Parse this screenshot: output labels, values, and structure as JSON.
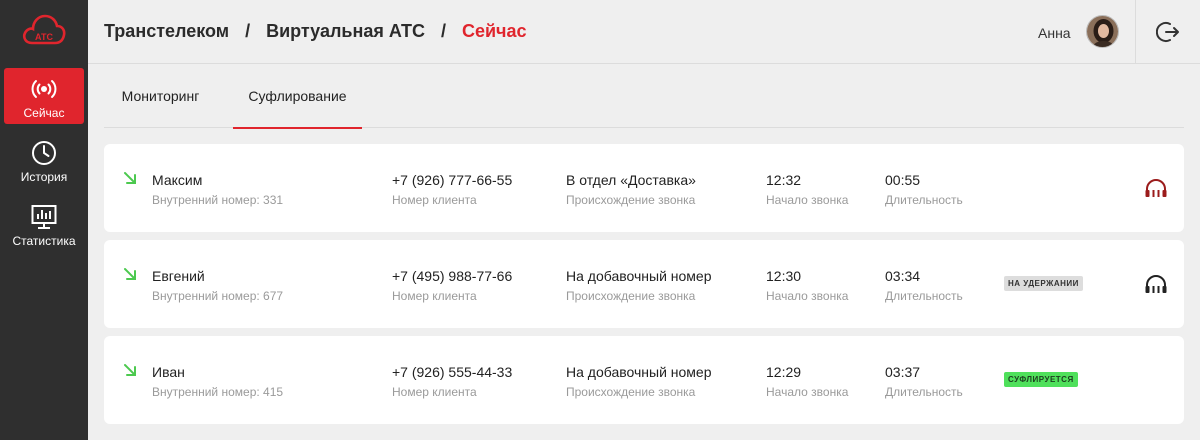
{
  "sidebar": {
    "logo_text": "АТС",
    "items": [
      {
        "label": "Сейчас",
        "icon": "broadcast-icon",
        "active": true
      },
      {
        "label": "История",
        "icon": "clock-icon",
        "active": false
      },
      {
        "label": "Статистика",
        "icon": "chart-monitor-icon",
        "active": false
      }
    ]
  },
  "header": {
    "breadcrumb": [
      "Транстелеком",
      "Виртуальная АТС",
      "Сейчас"
    ],
    "separator": "/",
    "user_name": "Анна"
  },
  "tabs": [
    {
      "label": "Мониторинг",
      "active": false
    },
    {
      "label": "Суфлирование",
      "active": true
    }
  ],
  "calls": [
    {
      "name": "Максим",
      "extension_label": "Внутренний номер: 331",
      "phone": "+7 (926) 777-66-55",
      "phone_label": "Номер клиента",
      "origin": "В отдел «Доставка»",
      "origin_label": "Происхождение звонка",
      "start": "12:32",
      "start_label": "Начало звонка",
      "duration": "00:55",
      "duration_label": "Длительность",
      "status": "",
      "listen_icon_color": "#9b1c1c"
    },
    {
      "name": "Евгений",
      "extension_label": "Внутренний номер: 677",
      "phone": "+7 (495) 988-77-66",
      "phone_label": "Номер клиента",
      "origin": "На добавочный номер",
      "origin_label": "Происхождение звонка",
      "start": "12:30",
      "start_label": "Начало звонка",
      "duration": "03:34",
      "duration_label": "Длительность",
      "status": "НА УДЕРЖАНИИ",
      "listen_icon_color": "#222222"
    },
    {
      "name": "Иван",
      "extension_label": "Внутренний номер: 415",
      "phone": "+7 (926) 555-44-33",
      "phone_label": "Номер клиента",
      "origin": "На добавочный номер",
      "origin_label": "Происхождение звонка",
      "start": "12:29",
      "start_label": "Начало звонка",
      "duration": "03:37",
      "duration_label": "Длительность",
      "status": "СУФЛИРУЕТСЯ"
    }
  ],
  "colors": {
    "accent": "#e0252d",
    "incoming_arrow": "#4cc94f",
    "sidebar_bg": "#2f2f2f",
    "hold_badge": "#dddddd",
    "listen_badge": "#4fe05b"
  }
}
